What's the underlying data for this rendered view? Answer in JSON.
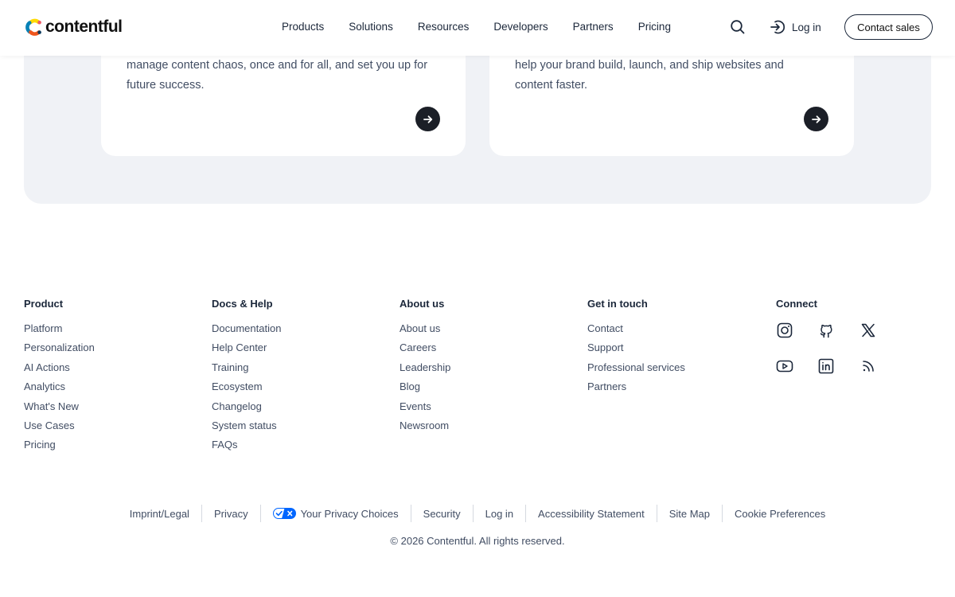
{
  "header": {
    "logo_text": "contentful",
    "nav": [
      "Products",
      "Solutions",
      "Resources",
      "Developers",
      "Partners",
      "Pricing"
    ],
    "login_label": "Log in",
    "contact_label": "Contact sales",
    "icons": {
      "search": "search-icon",
      "login": "login-arrow-icon"
    }
  },
  "cards": [
    {
      "text": "manage content chaos, once and for all, and set you up for future success."
    },
    {
      "text": "help your brand build, launch, and ship websites and content faster."
    }
  ],
  "footer": {
    "product": {
      "heading": "Product",
      "links": [
        "Platform",
        "Personalization",
        "AI Actions",
        "Analytics",
        "What's New",
        "Use Cases",
        "Pricing"
      ]
    },
    "docs": {
      "heading": "Docs & Help",
      "links": [
        "Documentation",
        "Help Center",
        "Training",
        "Ecosystem",
        "Changelog",
        "System status",
        "FAQs"
      ]
    },
    "about": {
      "heading": "About us",
      "links": [
        "About us",
        "Careers",
        "Leadership",
        "Blog",
        "Events",
        "Newsroom"
      ]
    },
    "touch": {
      "heading": "Get in touch",
      "links": [
        "Contact",
        "Support",
        "Professional services",
        "Partners"
      ]
    },
    "connect": {
      "heading": "Connect",
      "icons": [
        "instagram-icon",
        "github-icon",
        "x-icon",
        "youtube-icon",
        "linkedin-icon",
        "rss-icon"
      ]
    }
  },
  "legal": {
    "links": [
      "Imprint/Legal",
      "Privacy",
      "Your Privacy Choices",
      "Security",
      "Log in",
      "Accessibility Statement",
      "Site Map",
      "Cookie Preferences"
    ],
    "copyright": "© 2026 Contentful. All rights reserved."
  },
  "colors": {
    "brand_text": "#111111",
    "panel_bg": "#f0f2f6",
    "privacy_blue": "#0066ff"
  }
}
